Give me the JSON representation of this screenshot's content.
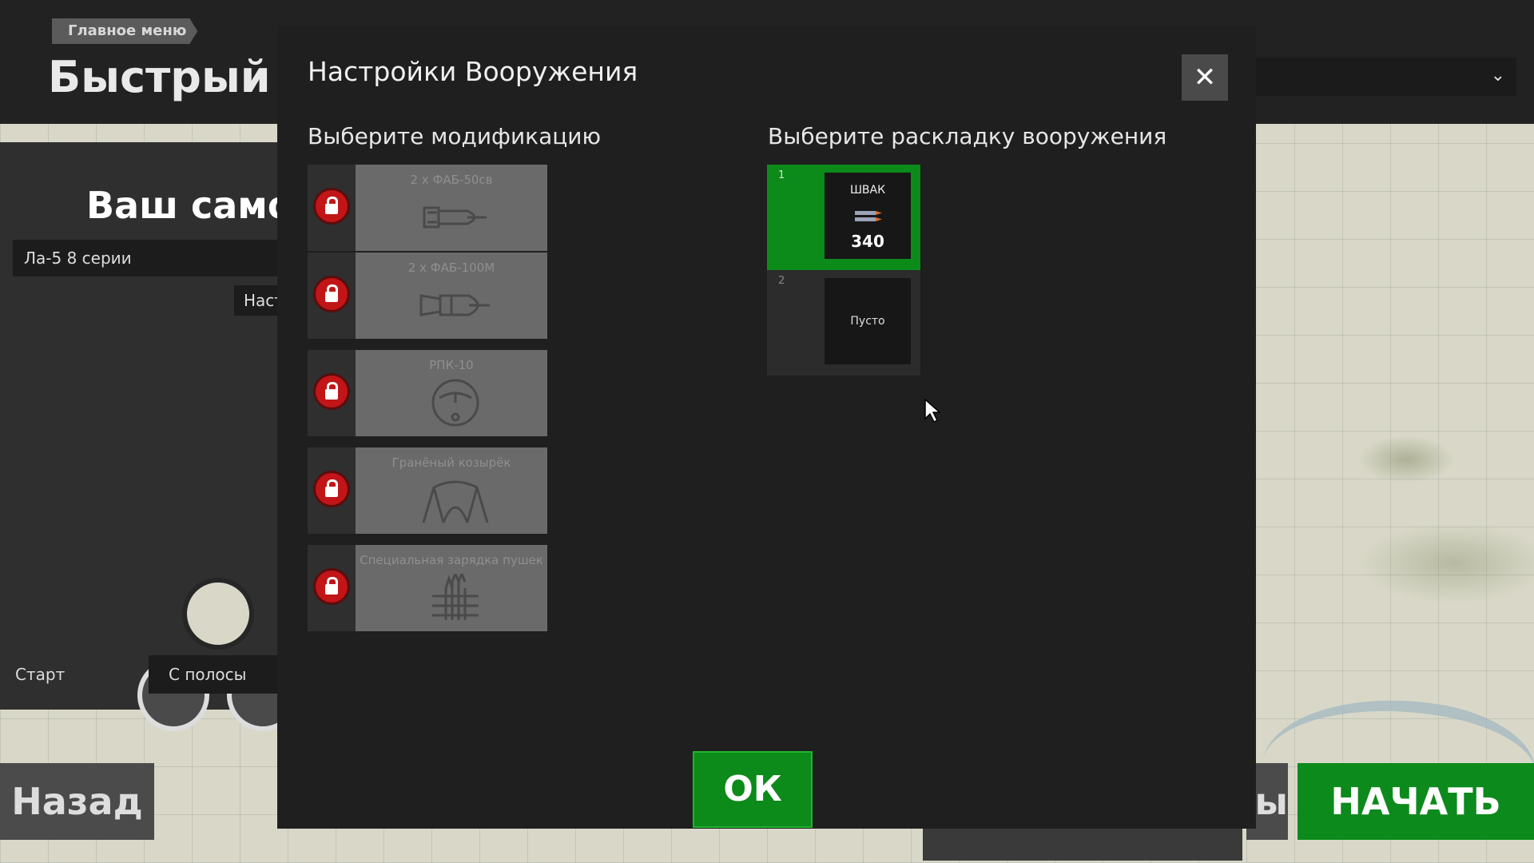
{
  "background": {
    "breadcrumb": "Главное меню",
    "page_title": "Быстрый вы",
    "left_panel": {
      "title": "Ваш самол",
      "plane": "Ла-5 8 серии",
      "settings_button": "Наст",
      "start_label": "Старт",
      "start_option": "С полосы"
    },
    "back_button": "Назад",
    "middle_button": "ы",
    "start_button": "НАЧАТЬ"
  },
  "dialog": {
    "title": "Настройки Вооружения",
    "close_label": "✕",
    "modifications_title": "Выберите модификацию",
    "loadout_title": "Выберите раскладку вооружения",
    "modifications": [
      {
        "name": "2 х ФАБ-50св",
        "icon": "small-bomb-icon",
        "locked": true
      },
      {
        "name": "2 х ФАБ-100М",
        "icon": "large-bomb-icon",
        "locked": true
      },
      {
        "name": "РПК-10",
        "icon": "radio-compass-icon",
        "locked": true
      },
      {
        "name": "Гранёный козырёк",
        "icon": "canopy-icon",
        "locked": true
      },
      {
        "name": "Специальная зарядка пушек",
        "icon": "ammo-belt-icon",
        "locked": true
      }
    ],
    "loadouts": [
      {
        "number": "1",
        "name": "ШВАК",
        "count": "340",
        "selected": true
      },
      {
        "number": "2",
        "name": "Пусто",
        "selected": false
      }
    ],
    "ok_button": "ОК"
  },
  "colors": {
    "accent_green": "#0c8a1a",
    "lock_red": "#c21517",
    "dialog_bg": "#1f1f1f"
  }
}
